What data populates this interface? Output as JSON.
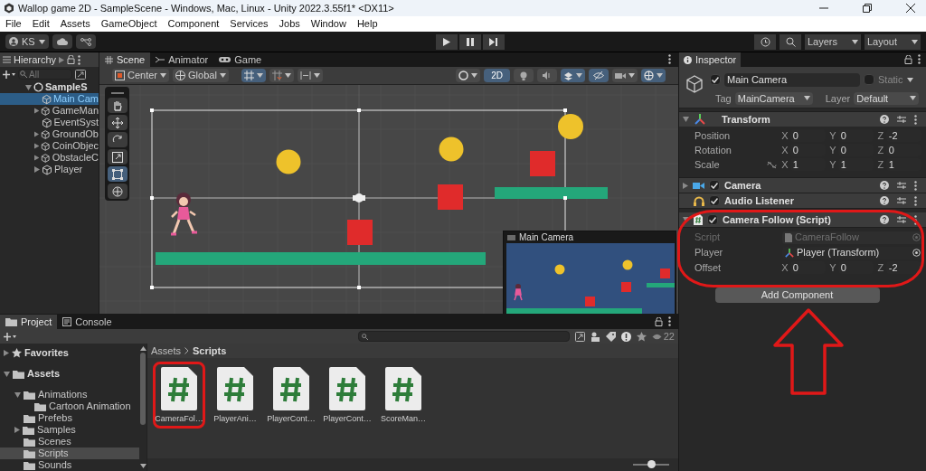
{
  "window": {
    "title": "Wallop game 2D - SampleScene - Windows, Mac, Linux - Unity 2022.3.55f1* <DX11>"
  },
  "menu": [
    "File",
    "Edit",
    "Assets",
    "GameObject",
    "Component",
    "Services",
    "Jobs",
    "Window",
    "Help"
  ],
  "toolbar": {
    "account": "KS",
    "layers": "Layers",
    "layout": "Layout"
  },
  "hierarchy": {
    "tab": "Hierarchy",
    "search_placeholder": "All",
    "scene": {
      "label": "SampleS",
      "expanded": true
    },
    "items": [
      {
        "label": "Main Cam",
        "selected": true,
        "expandable": false
      },
      {
        "label": "GameMan",
        "selected": false,
        "expandable": true
      },
      {
        "label": "EventSyst",
        "selected": false,
        "expandable": false
      },
      {
        "label": "GroundOb",
        "selected": false,
        "expandable": true
      },
      {
        "label": "CoinObjec",
        "selected": false,
        "expandable": true
      },
      {
        "label": "ObstacleC",
        "selected": false,
        "expandable": true
      },
      {
        "label": "Player",
        "selected": false,
        "expandable": true
      }
    ]
  },
  "scene_view": {
    "tabs": [
      {
        "label": "Scene",
        "kind": "scene",
        "selected": true
      },
      {
        "label": "Animator",
        "kind": "animator",
        "selected": false
      },
      {
        "label": "Game",
        "kind": "game",
        "selected": false
      }
    ],
    "pivot": "Center",
    "space": "Global",
    "mode_2d": {
      "label": "2D",
      "on": true
    },
    "lighting_on": false,
    "audio_on": false,
    "hidden_objects_on": true,
    "preview_title": "Main Camera"
  },
  "inspector": {
    "tab": "Inspector",
    "object_name": "Main Camera",
    "active": true,
    "static_label": "Static",
    "static": false,
    "tag_label": "Tag",
    "tag": "MainCamera",
    "layer_label": "Layer",
    "layer": "Default",
    "transform": {
      "title": "Transform",
      "rows": [
        {
          "label": "Position",
          "fields": [
            {
              "axis": "X",
              "value": "0"
            },
            {
              "axis": "Y",
              "value": "0"
            },
            {
              "axis": "Z",
              "value": "-2"
            }
          ]
        },
        {
          "label": "Rotation",
          "fields": [
            {
              "axis": "X",
              "value": "0"
            },
            {
              "axis": "Y",
              "value": "0"
            },
            {
              "axis": "Z",
              "value": "0"
            }
          ]
        },
        {
          "label": "Scale",
          "fields": [
            {
              "axis": "X",
              "value": "1"
            },
            {
              "axis": "Y",
              "value": "1"
            },
            {
              "axis": "Z",
              "value": "1"
            }
          ]
        }
      ]
    },
    "components": [
      {
        "title": "Camera",
        "kind": "camera",
        "enabled": true,
        "expanded": false,
        "highlighted": false
      },
      {
        "title": "Audio Listener",
        "kind": "audio",
        "enabled": true,
        "highlighted": false
      },
      {
        "title": "Camera Follow (Script)",
        "kind": "script",
        "enabled": true,
        "expanded": true,
        "highlighted": true
      }
    ],
    "script_fields": {
      "script_label": "Script",
      "script": "CameraFollow",
      "player_label": "Player",
      "player": "Player (Transform)",
      "offset": {
        "label": "Offset",
        "fields": [
          {
            "axis": "X",
            "value": "0"
          },
          {
            "axis": "Y",
            "value": "0"
          },
          {
            "axis": "Z",
            "value": "-2"
          }
        ]
      }
    },
    "add_component": "Add Component",
    "callout_arrow": true
  },
  "project": {
    "tabs": [
      {
        "label": "Project",
        "kind": "project",
        "selected": true
      },
      {
        "label": "Console",
        "kind": "console",
        "selected": false
      }
    ],
    "count": "22",
    "tree": [
      {
        "label": "Favorites",
        "kind": "favorites",
        "expanded": false,
        "selected": false
      },
      {
        "label": "Assets",
        "kind": "folder",
        "expanded": true,
        "selected": false,
        "children": [
          {
            "label": "Animations",
            "kind": "folder",
            "expanded": true,
            "selected": false,
            "children": [
              {
                "label": "Cartoon Animation",
                "kind": "folder",
                "selected": false
              }
            ]
          },
          {
            "label": "Prefebs",
            "kind": "folder",
            "selected": false
          },
          {
            "label": "Samples",
            "kind": "folder",
            "expanded": false,
            "selected": false
          },
          {
            "label": "Scenes",
            "kind": "folder",
            "selected": false
          },
          {
            "label": "Scripts",
            "kind": "folder",
            "selected": true
          },
          {
            "label": "Sounds",
            "kind": "folder",
            "selected": false
          }
        ]
      }
    ],
    "breadcrumb": [
      "Assets",
      "Scripts"
    ],
    "files": [
      {
        "label": "CameraFol…",
        "highlighted": true
      },
      {
        "label": "PlayerAni…",
        "highlighted": false
      },
      {
        "label": "PlayerCont…",
        "highlighted": false
      },
      {
        "label": "PlayerCont…",
        "highlighted": false
      },
      {
        "label": "ScoreMan…",
        "highlighted": false
      }
    ],
    "icon_size": {
      "level": 0.5
    }
  }
}
